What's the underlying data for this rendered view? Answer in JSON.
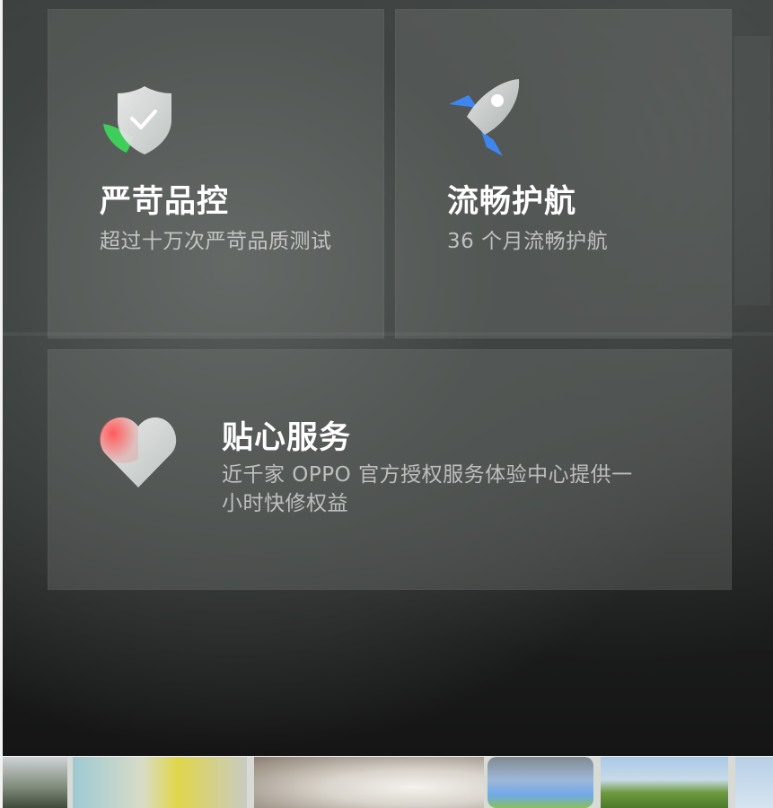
{
  "cards": [
    {
      "title": "严苛品控",
      "desc": "超过十万次严苛品质测试",
      "icon": "shield-check-icon"
    },
    {
      "title": "流畅护航",
      "desc": "36 个月流畅护航",
      "icon": "rocket-icon"
    },
    {
      "title": "贴心服务",
      "desc": "近千家 OPPO 官方授权服务体验中心提供一小时快修权益",
      "icon": "heart-icon"
    }
  ],
  "thumbnails": [
    "street-photo-thumbnail",
    "water-gun-photo-thumbnail",
    "dog-photo-thumbnail",
    "sky-photo-thumbnail",
    "field-photo-thumbnail",
    "sky-edge-thumbnail"
  ],
  "colors": {
    "card_fill": "#787d7a",
    "title": "#ffffff",
    "desc": "#a9acaa",
    "shield_green": "#3fce5a",
    "rocket_blue": "#3d86f0",
    "heart_red": "#ff4d4d"
  }
}
